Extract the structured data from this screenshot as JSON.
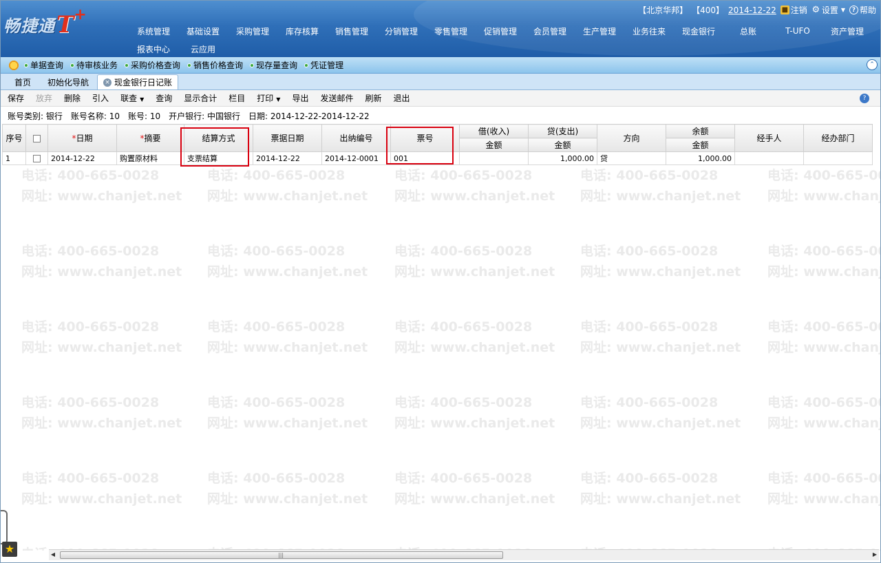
{
  "header": {
    "logo_text": "畅捷通",
    "logo_brand": "T",
    "logo_plus": "+",
    "user": {
      "company": "【北京华邦】",
      "account": "【400】",
      "date": "2014-12-22",
      "logout": "注销",
      "settings": "设置",
      "help": "帮助"
    },
    "menu_row1": [
      "系统管理",
      "基础设置",
      "采购管理",
      "库存核算",
      "销售管理",
      "分销管理",
      "零售管理",
      "促销管理",
      "会员管理",
      "生产管理",
      "业务往来",
      "现金银行",
      "总账",
      "T-UFO",
      "资产管理"
    ],
    "menu_row2": [
      "报表中心",
      "云应用"
    ]
  },
  "subnav": [
    "单据查询",
    "待审核业务",
    "采购价格查询",
    "销售价格查询",
    "现存量查询",
    "凭证管理"
  ],
  "tabs": [
    {
      "label": "首页"
    },
    {
      "label": "初始化导航"
    },
    {
      "label": "现金银行日记账"
    }
  ],
  "toolbar": {
    "save": "保存",
    "discard": "放弃",
    "delete": "删除",
    "import": "引入",
    "link": "联查",
    "query": "查询",
    "show_total": "显示合计",
    "columns": "栏目",
    "print": "打印",
    "export": "导出",
    "send_mail": "发送邮件",
    "refresh": "刷新",
    "exit": "退出"
  },
  "info": {
    "type": "账号类别: 银行",
    "name": "账号名称: 10",
    "number": "账号: 10",
    "bank": "开户银行: 中国银行",
    "date": "日期: 2014-12-22-2014-12-22"
  },
  "table": {
    "headers": {
      "seq": "序号",
      "date": "日期",
      "summary": "摘要",
      "settle": "结算方式",
      "bill_date": "票据日期",
      "cashier_no": "出纳编号",
      "ticket_no": "票号",
      "debit": "借(收入)",
      "credit": "贷(支出)",
      "amount": "金额",
      "direction": "方向",
      "balance": "余额",
      "handler": "经手人",
      "dept": "经办部门"
    },
    "required_mark": "*",
    "rows": [
      {
        "seq": "1",
        "date": "2014-12-22",
        "summary": "购置原材料",
        "settle": "支票结算",
        "bill_date": "2014-12-22",
        "cashier_no": "2014-12-0001",
        "ticket_no": "001",
        "debit": "",
        "credit": "1,000.00",
        "direction": "贷",
        "balance": "1,000.00",
        "handler": "",
        "dept": ""
      }
    ]
  },
  "watermark": {
    "phone": "电话: 400-665-0028",
    "site": "网址: www.chanjet.net"
  },
  "colors": {
    "header_blue": "#2f6fb8",
    "highlight_red": "#d9000f"
  }
}
